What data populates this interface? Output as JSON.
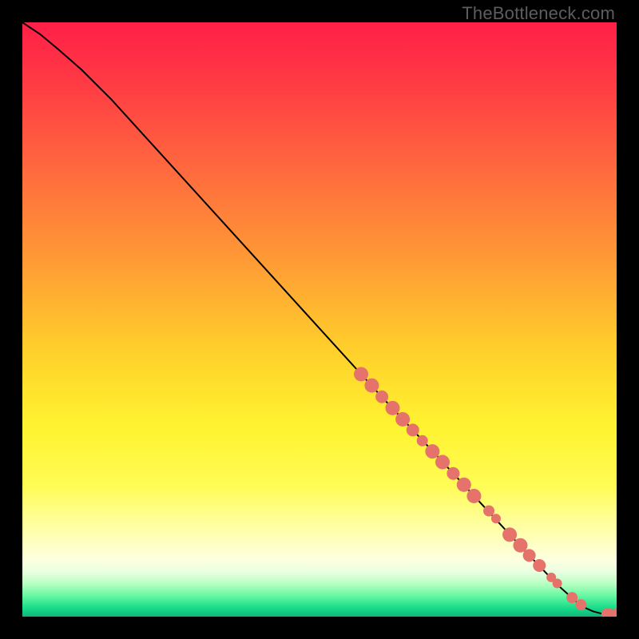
{
  "watermark": "TheBottleneck.com",
  "chart_data": {
    "type": "line",
    "title": "",
    "xlabel": "",
    "ylabel": "",
    "xlim": [
      0,
      100
    ],
    "ylim": [
      0,
      100
    ],
    "grid": false,
    "legend": false,
    "series": [
      {
        "name": "curve",
        "kind": "line",
        "x": [
          0,
          3,
          6,
          10,
          15,
          20,
          30,
          40,
          50,
          60,
          70,
          80,
          85,
          90,
          94,
          96,
          97.5,
          98.5,
          99.3,
          100
        ],
        "y": [
          100,
          98,
          95.5,
          92,
          87,
          81.5,
          70.5,
          59.5,
          48.5,
          37.5,
          26.8,
          16.0,
          10.6,
          5.4,
          1.8,
          0.9,
          0.5,
          0.35,
          0.3,
          0.28
        ]
      },
      {
        "name": "markers",
        "kind": "scatter",
        "color": "#e5736b",
        "points": [
          {
            "x": 57.0,
            "y": 40.8,
            "r": 9
          },
          {
            "x": 58.8,
            "y": 38.9,
            "r": 9
          },
          {
            "x": 60.5,
            "y": 37.0,
            "r": 8
          },
          {
            "x": 62.3,
            "y": 35.1,
            "r": 9
          },
          {
            "x": 64.0,
            "y": 33.2,
            "r": 9
          },
          {
            "x": 65.7,
            "y": 31.4,
            "r": 8
          },
          {
            "x": 67.3,
            "y": 29.6,
            "r": 7
          },
          {
            "x": 69.0,
            "y": 27.8,
            "r": 9
          },
          {
            "x": 70.7,
            "y": 26.0,
            "r": 9
          },
          {
            "x": 72.5,
            "y": 24.1,
            "r": 8
          },
          {
            "x": 74.3,
            "y": 22.2,
            "r": 9
          },
          {
            "x": 76.0,
            "y": 20.3,
            "r": 9
          },
          {
            "x": 78.5,
            "y": 17.8,
            "r": 7
          },
          {
            "x": 79.7,
            "y": 16.5,
            "r": 6
          },
          {
            "x": 82.0,
            "y": 13.8,
            "r": 9
          },
          {
            "x": 83.8,
            "y": 12.0,
            "r": 9
          },
          {
            "x": 85.3,
            "y": 10.3,
            "r": 8
          },
          {
            "x": 87.0,
            "y": 8.6,
            "r": 8
          },
          {
            "x": 89.0,
            "y": 6.6,
            "r": 6
          },
          {
            "x": 90.0,
            "y": 5.6,
            "r": 6
          },
          {
            "x": 92.5,
            "y": 3.2,
            "r": 7
          },
          {
            "x": 94.0,
            "y": 2.0,
            "r": 7
          },
          {
            "x": 98.5,
            "y": 0.4,
            "r": 8
          },
          {
            "x": 100.0,
            "y": 0.3,
            "r": 8
          }
        ]
      }
    ],
    "background_gradient": {
      "stops": [
        {
          "offset": 0.0,
          "color": "#ff1f47"
        },
        {
          "offset": 0.1,
          "color": "#ff3a44"
        },
        {
          "offset": 0.25,
          "color": "#ff6a3e"
        },
        {
          "offset": 0.4,
          "color": "#ff9a35"
        },
        {
          "offset": 0.55,
          "color": "#ffcf2b"
        },
        {
          "offset": 0.68,
          "color": "#fff330"
        },
        {
          "offset": 0.78,
          "color": "#fffc55"
        },
        {
          "offset": 0.86,
          "color": "#ffffb0"
        },
        {
          "offset": 0.905,
          "color": "#fdffe0"
        },
        {
          "offset": 0.925,
          "color": "#e8ffe0"
        },
        {
          "offset": 0.945,
          "color": "#b7ffc1"
        },
        {
          "offset": 0.965,
          "color": "#66f7a2"
        },
        {
          "offset": 0.985,
          "color": "#19dd8a"
        },
        {
          "offset": 1.0,
          "color": "#0fb57a"
        }
      ]
    }
  }
}
